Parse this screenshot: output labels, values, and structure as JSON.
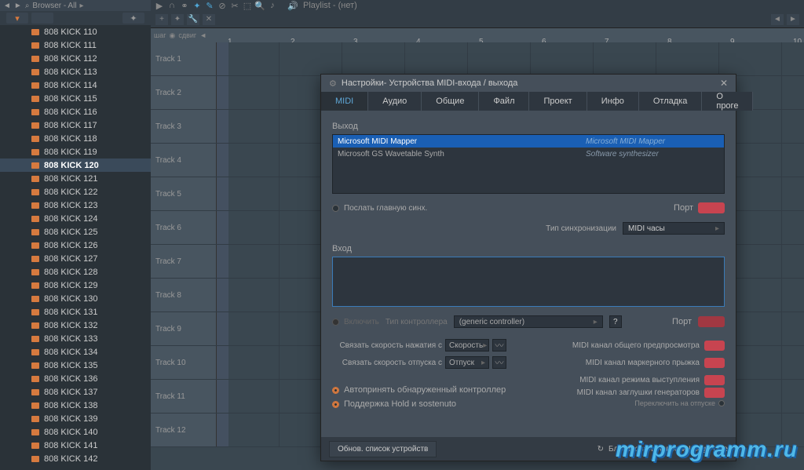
{
  "browser": {
    "title": "Browser - All",
    "items": [
      {
        "label": "808 KICK 110"
      },
      {
        "label": "808 KICK 111"
      },
      {
        "label": "808 KICK 112"
      },
      {
        "label": "808 KICK 113"
      },
      {
        "label": "808 KICK 114"
      },
      {
        "label": "808 KICK 115"
      },
      {
        "label": "808 KICK 116"
      },
      {
        "label": "808 KICK 117"
      },
      {
        "label": "808 KICK 118"
      },
      {
        "label": "808 KICK 119"
      },
      {
        "label": "808 KICK 120",
        "selected": true
      },
      {
        "label": "808 KICK 121"
      },
      {
        "label": "808 KICK 122"
      },
      {
        "label": "808 KICK 123"
      },
      {
        "label": "808 KICK 124"
      },
      {
        "label": "808 KICK 125"
      },
      {
        "label": "808 KICK 126"
      },
      {
        "label": "808 KICK 127"
      },
      {
        "label": "808 KICK 128"
      },
      {
        "label": "808 KICK 129"
      },
      {
        "label": "808 KICK 130"
      },
      {
        "label": "808 KICK 131"
      },
      {
        "label": "808 KICK 132"
      },
      {
        "label": "808 KICK 133"
      },
      {
        "label": "808 KICK 134"
      },
      {
        "label": "808 KICK 135"
      },
      {
        "label": "808 KICK 136"
      },
      {
        "label": "808 KICK 137"
      },
      {
        "label": "808 KICK 138"
      },
      {
        "label": "808 KICK 139"
      },
      {
        "label": "808 KICK 140"
      },
      {
        "label": "808 KICK 141"
      },
      {
        "label": "808 KICK 142"
      }
    ]
  },
  "playlist": {
    "label": "Playlist - (нет)",
    "ruler_controls": {
      "step": "шаг",
      "shift": "сдвиг"
    },
    "ruler_numbers": [
      1,
      2,
      3,
      4,
      5,
      6,
      7,
      8,
      9,
      10
    ],
    "tracks": [
      "Track 1",
      "Track 2",
      "Track 3",
      "Track 4",
      "Track 5",
      "Track 6",
      "Track 7",
      "Track 8",
      "Track 9",
      "Track 10",
      "Track 11",
      "Track 12"
    ]
  },
  "dialog": {
    "title": "Настройки- Устройства MIDI-входа / выхода",
    "tabs": [
      "MIDI",
      "Аудио",
      "Общие",
      "Файл",
      "Проект",
      "Инфо",
      "Отладка",
      "О проге"
    ],
    "active_tab": 0,
    "output": {
      "label": "Выход",
      "rows": [
        {
          "name": "Microsoft MIDI Mapper",
          "desc": "Microsoft MIDI Mapper",
          "selected": true
        },
        {
          "name": "Microsoft GS Wavetable Synth",
          "desc": "Software synthesizer",
          "selected": false
        }
      ],
      "send_sync": "Послать главную синх.",
      "port_label": "Порт",
      "sync_type_label": "Тип синхронизации",
      "sync_type_value": "MIDI часы"
    },
    "input": {
      "label": "Вход",
      "enable": "Включить",
      "controller_type_label": "Тип контроллера",
      "controller_type_value": "(generic controller)",
      "port_label": "Порт"
    },
    "links": {
      "press": {
        "label": "Связать скорость нажатия с",
        "value": "Скорость"
      },
      "release": {
        "label": "Связать скорость отпуска с",
        "value": "Отпуск"
      },
      "preview": "MIDI канал общего предпросмотра",
      "marker": "MIDI канал маркерного прыжка",
      "perform": "MIDI канал режима выступления",
      "mute": "MIDI канал заглушки генераторов",
      "note": "Переключить на отпуске"
    },
    "auto": {
      "accept": "Автопринять обнаруженный контроллер",
      "sostenuto": "Поддержка Hold и sostenuto"
    },
    "footer": {
      "refresh": "Обнов. список устройств",
      "news": "Блокировать новости Image-Line"
    }
  },
  "watermark": "mirprogramm.ru"
}
